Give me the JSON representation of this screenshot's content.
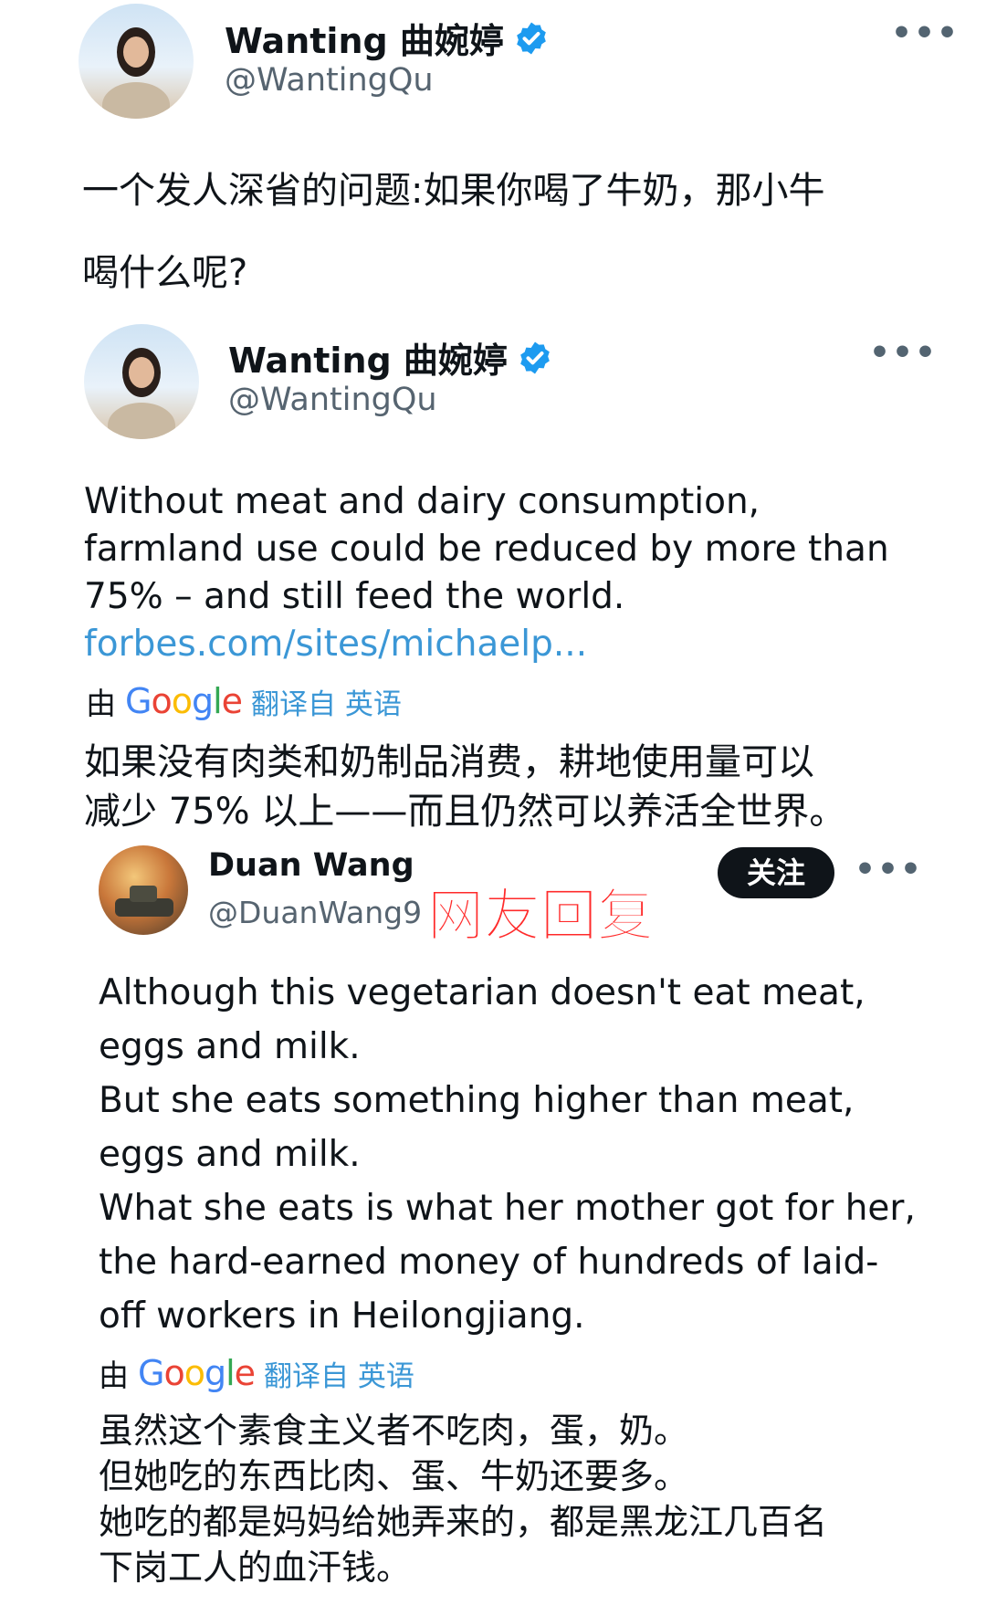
{
  "tweet1": {
    "name": "Wanting 曲婉婷",
    "handle": "@WantingQu",
    "more": "•••",
    "text_line1": "一个发人深省的问题:如果你喝了牛奶，那小牛",
    "text_line2": "喝什么呢?"
  },
  "quoted_tweet": {
    "name": "Wanting 曲婉婷",
    "handle": "@WantingQu",
    "more": "•••",
    "text_line1": "Without meat and dairy consumption,",
    "text_line2": "farmland use could be reduced by more than",
    "text_line3": "75% – and still feed the world.",
    "link": "forbes.com/sites/michaelp...",
    "translate_by": "由",
    "translate_brand": "Google",
    "translate_label": "翻译自 英语",
    "translation_line1": "如果没有肉类和奶制品消费，耕地使用量可以",
    "translation_line2": "减少 75% 以上——而且仍然可以养活全世界。"
  },
  "reply": {
    "name": "Duan Wang",
    "handle": "@DuanWang9",
    "annotation": "网友回复",
    "follow_label": "关注",
    "more": "•••",
    "text_lines": [
      "Although this vegetarian doesn't eat meat,",
      "eggs and milk.",
      "But she eats something higher than meat,",
      "eggs and milk.",
      "What she eats is what her mother got for her,",
      "the hard-earned money of hundreds of laid-",
      "off workers in Heilongjiang."
    ],
    "translate_by": "由",
    "translate_brand": "Google",
    "translate_label": "翻译自 英语",
    "translation_lines": [
      "虽然这个素食主义者不吃肉，蛋，奶。",
      "但她吃的东西比肉、蛋、牛奶还要多。",
      "她吃的都是妈妈给她弄来的，都是黑龙江几百名",
      "下岗工人的血汗钱。"
    ]
  },
  "colors": {
    "link_blue": "#3b97d6",
    "verified_blue": "#1d9bf0",
    "annotation_red": "#ff2a2a",
    "follow_button_bg": "#0f1419"
  },
  "icons": [
    "verified-badge-icon",
    "more-options-icon"
  ]
}
